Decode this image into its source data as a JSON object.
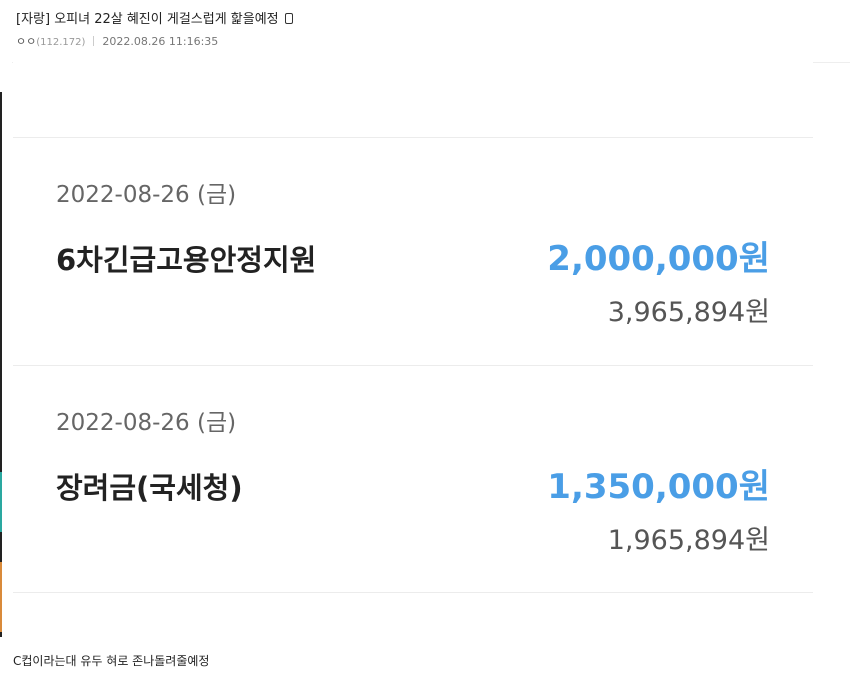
{
  "post": {
    "title": "[자랑] 오피녀 22살 혜진이 게걸스럽게 핥을예정",
    "author": "ㅇㅇ",
    "ip": "(112.172)",
    "datetime": "2022.08.26 11:16:35"
  },
  "transactions": [
    {
      "date": "2022-08-26 (금)",
      "name": "6차긴급고용안정지원",
      "amount": "2,000,000원",
      "balance": "3,965,894원"
    },
    {
      "date": "2022-08-26 (금)",
      "name": "장려금(국세청)",
      "amount": "1,350,000원",
      "balance": "1,965,894원"
    }
  ],
  "body_text": "C컵이라는대 유두 혀로 존나돌려줄예정",
  "colors": {
    "amount": "#4a9ee6",
    "divider": "#ececec"
  }
}
